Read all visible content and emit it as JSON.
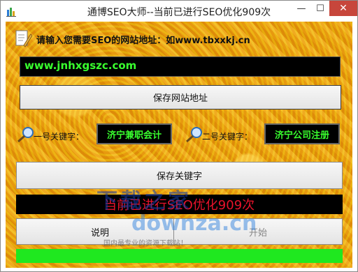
{
  "window": {
    "title": "通博SEO大师--当前已进行SEO优化909次",
    "minimize_glyph": "—",
    "maximize_glyph": "☐",
    "close_glyph": "✕"
  },
  "icons": {
    "app": "app-icon",
    "document": "document-pencil-icon",
    "key": "magnifier-key-icon"
  },
  "site": {
    "prompt": "请输入您需要SEO的网站地址：如www.tbxxkj.cn",
    "url_value": "www.jnhxgszc.com",
    "save_button": "保存网站地址"
  },
  "keywords": {
    "kw1_label": "一号关键字：",
    "kw1_value": "济宁兼职会计",
    "kw2_label": "二号关键字：",
    "kw2_value": "济宁公司注册",
    "save_button": "保存关键字"
  },
  "status": {
    "text": "当前已进行SEO优化909次"
  },
  "actions": {
    "help_button": "说明",
    "start_button": "开始"
  },
  "progress": {
    "value": 1.0
  },
  "watermark": {
    "line1": "下载之家",
    "line2": "downza.cn",
    "line3": "国内最专业的资源下载站！"
  },
  "colors": {
    "accent_green": "#39ff2e",
    "status_red": "#e8122b",
    "progress_green": "#1fe81f",
    "close_red": "#c7463b"
  }
}
